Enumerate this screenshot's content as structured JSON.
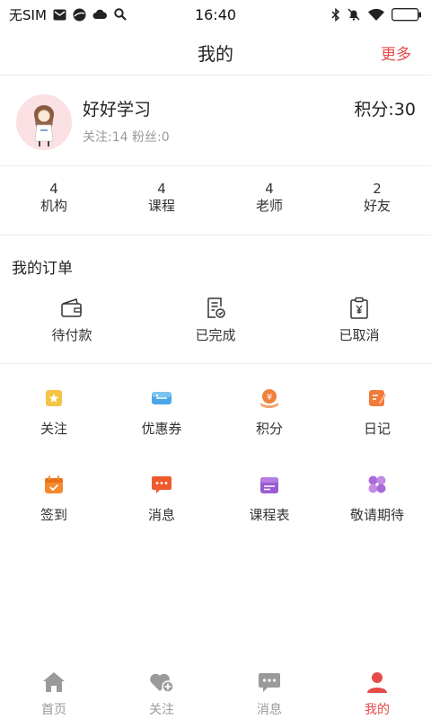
{
  "status_bar": {
    "carrier": "无SIM",
    "time": "16:40"
  },
  "header": {
    "title": "我的",
    "more_label": "更多"
  },
  "profile": {
    "username": "好好学习",
    "follow_stats": "关注:14 粉丝:0",
    "points": "积分:30"
  },
  "stats": [
    {
      "num": "4",
      "label": "机构"
    },
    {
      "num": "4",
      "label": "课程"
    },
    {
      "num": "4",
      "label": "老师"
    },
    {
      "num": "2",
      "label": "好友"
    }
  ],
  "orders": {
    "title": "我的订单",
    "items": [
      {
        "label": "待付款",
        "icon": "wallet-icon"
      },
      {
        "label": "已完成",
        "icon": "completed-order-icon"
      },
      {
        "label": "已取消",
        "icon": "cancelled-order-icon"
      }
    ]
  },
  "grid": [
    {
      "label": "关注",
      "icon": "star-bookmark-icon"
    },
    {
      "label": "优惠券",
      "icon": "coupon-icon"
    },
    {
      "label": "积分",
      "icon": "points-coin-icon"
    },
    {
      "label": "日记",
      "icon": "diary-icon"
    },
    {
      "label": "签到",
      "icon": "checkin-calendar-icon"
    },
    {
      "label": "消息",
      "icon": "message-bubble-icon"
    },
    {
      "label": "课程表",
      "icon": "schedule-icon"
    },
    {
      "label": "敬请期待",
      "icon": "clover-icon"
    }
  ],
  "bottom_nav": [
    {
      "label": "首页",
      "icon": "home-icon"
    },
    {
      "label": "关注",
      "icon": "heart-plus-icon"
    },
    {
      "label": "消息",
      "icon": "chat-icon"
    },
    {
      "label": "我的",
      "icon": "user-icon",
      "active": true
    }
  ],
  "colors": {
    "accent": "#e54b4b",
    "inactive": "#999999",
    "divider": "#ececec"
  }
}
